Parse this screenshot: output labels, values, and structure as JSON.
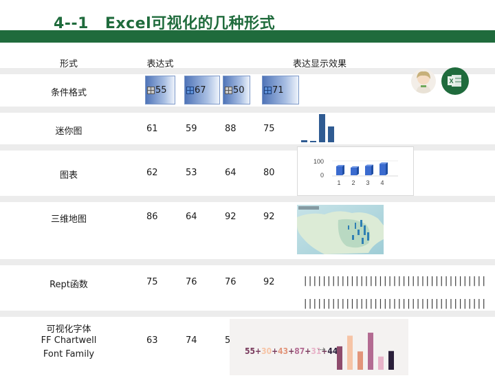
{
  "title": {
    "number": "4--1",
    "text": "Excel可视化的几种形式"
  },
  "headers": {
    "form": "形式",
    "expression": "表达式",
    "effect": "表达显示效果"
  },
  "rows": {
    "conditional": {
      "label": "条件格式",
      "values": [
        "55",
        "67",
        "50",
        "71"
      ],
      "fill_fractions": [
        0.55,
        0.67,
        0.5,
        0.71
      ]
    },
    "sparkline": {
      "label": "迷你图",
      "values": [
        "61",
        "59",
        "88",
        "75"
      ]
    },
    "chart": {
      "label": "图表",
      "values": [
        "62",
        "53",
        "64",
        "80"
      ]
    },
    "map3d": {
      "label": "三维地图",
      "values": [
        "86",
        "64",
        "92",
        "92"
      ]
    },
    "rept": {
      "label": "Rept函数",
      "values": [
        "75",
        "76",
        "76",
        "92"
      ],
      "bars_line1": "||||||||||||||||||||||||||||||||||||||||||||||||||||||||||||||||||||||||||||||||||||||||||",
      "bars_line2": "|||||||||||||||||||||||||||||||||||||||||||||||||||||||||||||||||||||||||||||||||||||||||||"
    },
    "font": {
      "label_line1": "可视化字体",
      "label_line2": "FF Chartwell",
      "label_line3": "Font Family",
      "values": [
        "63",
        "74",
        "5"
      ]
    }
  },
  "sparkline_values": [
    3,
    2,
    40,
    22
  ],
  "chart_data": {
    "type": "bar",
    "categories": [
      "1",
      "2",
      "3",
      "4"
    ],
    "values": [
      62,
      53,
      64,
      80
    ],
    "ylim": [
      0,
      100
    ],
    "yticks": [
      "100",
      "0"
    ],
    "color": "#3b6bcf"
  },
  "font_demo": {
    "parts": [
      {
        "text": "55",
        "color": "#7a3c5e"
      },
      {
        "text": "+",
        "color": "#7a3c5e"
      },
      {
        "text": "30",
        "color": "#f6c4a6"
      },
      {
        "text": "+",
        "color": "#7a3c5e"
      },
      {
        "text": "43",
        "color": "#e2957a"
      },
      {
        "text": "+",
        "color": "#7a3c5e"
      },
      {
        "text": "87",
        "color": "#b36b92"
      },
      {
        "text": "+",
        "color": "#7a3c5e"
      },
      {
        "text": "31",
        "color": "#e8b3c9"
      },
      {
        "text": "+",
        "color": "#7a3c5e"
      },
      {
        "text": "44",
        "color": "#2a1f3a"
      }
    ],
    "arrow": "⇢",
    "bars": [
      {
        "value": 55,
        "color": "#8e4b6c"
      },
      {
        "value": 80,
        "color": "#f6c4a6"
      },
      {
        "value": 43,
        "color": "#e2957a"
      },
      {
        "value": 87,
        "color": "#b36b92"
      },
      {
        "value": 31,
        "color": "#e8b3c9"
      },
      {
        "value": 44,
        "color": "#2a1f3a"
      }
    ]
  },
  "colors": {
    "brand_green": "#1f6b3c",
    "band_gray": "#ececec",
    "spark_blue": "#2f5b92"
  }
}
